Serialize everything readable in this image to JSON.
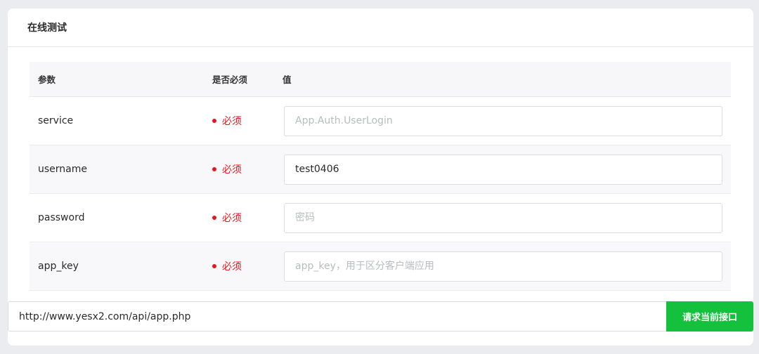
{
  "card": {
    "title": "在线测试"
  },
  "table": {
    "headers": {
      "param": "参数",
      "required": "是否必须",
      "value": "值"
    },
    "rows": [
      {
        "name": "service",
        "required_label": "必须",
        "value": "",
        "placeholder": "App.Auth.UserLogin"
      },
      {
        "name": "username",
        "required_label": "必须",
        "value": "test0406",
        "placeholder": ""
      },
      {
        "name": "password",
        "required_label": "必须",
        "value": "",
        "placeholder": "密码"
      },
      {
        "name": "app_key",
        "required_label": "必须",
        "value": "",
        "placeholder": "app_key，用于区分客户端应用"
      }
    ]
  },
  "request": {
    "url": "http://www.yesx2.com/api/app.php",
    "submit_label": "请求当前接口"
  },
  "colors": {
    "required": "#e4161f",
    "submit_button": "#13c13c",
    "background": "#ebecef"
  }
}
